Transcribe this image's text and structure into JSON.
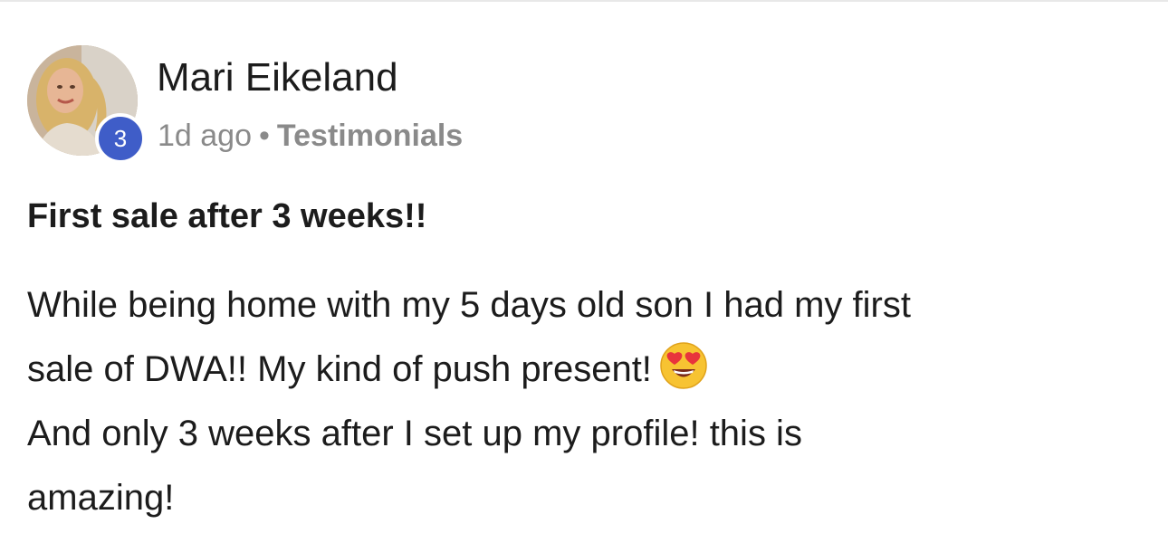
{
  "post": {
    "author": {
      "name": "Mari Eikeland",
      "level": "3"
    },
    "time_ago": "1d ago",
    "separator": "•",
    "category": "Testimonials",
    "title": "First sale after 3 weeks!!",
    "body_lines": [
      "While being home with my 5 days old son I had my first",
      "sale of DWA!! My kind of push present!",
      "And only 3 weeks after I set up my profile! this is",
      "amazing!"
    ],
    "emoji": "heart-eyes-emoji"
  },
  "colors": {
    "level_badge": "#3f5dc8",
    "meta_text": "#8a8a8a",
    "main_text": "#1c1c1c"
  }
}
